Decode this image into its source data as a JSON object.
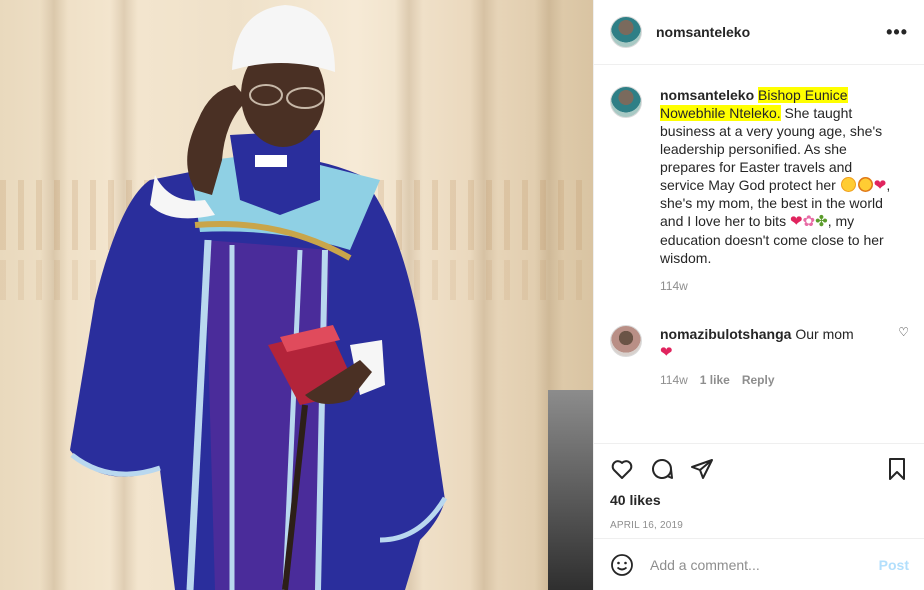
{
  "header": {
    "username": "nomsanteleko",
    "more_icon": "more-horizontal-icon"
  },
  "caption": {
    "username": "nomsanteleko",
    "highlight": "Bishop Eunice Nowebhile Nteleko.",
    "text_1": " She taught business at a very young age, she's leadership personified. As she prepares for Easter travels and service May God protect her ",
    "text_2": ", she's my mom, the best in the world and I love her to bits ",
    "text_3": ", my education doesn't come close to her wisdom.",
    "time": "114w"
  },
  "comment": {
    "username": "nomazibulotshanga",
    "text": "Our mom",
    "time": "114w",
    "likes": "1 like",
    "reply": "Reply"
  },
  "actions": {
    "likes": "40 likes",
    "date": "April 16, 2019"
  },
  "add_comment": {
    "placeholder": "Add a comment...",
    "post": "Post"
  },
  "colors": {
    "highlight": "#ffff00",
    "post_disabled": "#b2dffc",
    "heart": "#e0245e"
  }
}
